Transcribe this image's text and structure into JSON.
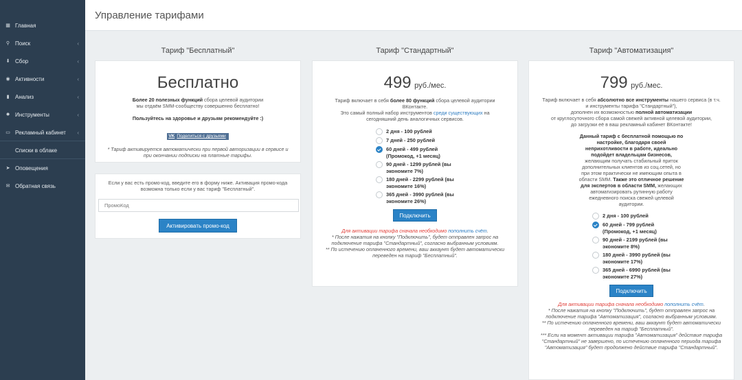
{
  "sidebar": {
    "items": [
      {
        "label": "Главная",
        "icon": "grid-icon",
        "chevron": false
      },
      {
        "label": "Поиск",
        "icon": "search-icon",
        "chevron": true
      },
      {
        "label": "Сбор",
        "icon": "download-icon",
        "chevron": true
      },
      {
        "label": "Активности",
        "icon": "eye-icon",
        "chevron": true
      },
      {
        "label": "Анализ",
        "icon": "chart-icon",
        "chevron": true
      },
      {
        "label": "Инструменты",
        "icon": "gear-icon",
        "chevron": true
      },
      {
        "label": "Рекламный кабинет",
        "icon": "monitor-icon",
        "chevron": true
      },
      {
        "label": "Списки в облаке",
        "icon": "list-icon",
        "chevron": false
      },
      {
        "label": "Оповещения",
        "icon": "send-icon",
        "chevron": false
      },
      {
        "label": "Обратная связь",
        "icon": "mail-icon",
        "chevron": false
      }
    ]
  },
  "header": {
    "title": "Управление тарифами"
  },
  "free": {
    "title": "Тариф \"Бесплатный\"",
    "price": "Бесплатно",
    "desc_bold": "Более 20 полезных функций",
    "desc_1": " сбора целевой аудитории",
    "desc_2": "мы отдаём SMM-сообществу совершенно бесплатно!",
    "recommend": "Пользуйтесь на здоровье и друзьям рекомендуйте :)",
    "vk_label": "VK",
    "share_label": "Поделиться с друзьями",
    "note": "* Тариф активируется автоматически при первой авторизации в сервисе и при окончании подписки на платные тарифы."
  },
  "promo": {
    "text": "Если у вас есть промо-код, введите его в форму ниже. Активация промо-кода возможна только если у вас тариф \"Бесплатный\".",
    "placeholder": "ПромоКод",
    "button": "Активировать промо-код"
  },
  "standard": {
    "title": "Тариф \"Стандартный\"",
    "price": "499",
    "unit": "руб./мес.",
    "desc_a": "Тариф включает в себя ",
    "desc_bold": "более 80 функций",
    "desc_b": " сбора целевой аудитории ВКонтакте.",
    "desc_c": "Это самый полный набор инструментов ",
    "desc_link": "среди существующих",
    "desc_d": " на сегодняшний день аналогичных сервисов.",
    "options": [
      {
        "label": "2 дня - 100 рублей",
        "checked": false
      },
      {
        "label": "7 дней - 250 рублей",
        "checked": false
      },
      {
        "label": "60 дней - 499 рублей (Промокод, +1 месяц)",
        "checked": true
      },
      {
        "label": "90 дней - 1299 рублей (вы экономите 7%)",
        "checked": false
      },
      {
        "label": "180 дней - 2299 рублей (вы экономите 16%)",
        "checked": false
      },
      {
        "label": "365 дней - 3990 рублей (вы экономите 26%)",
        "checked": false
      }
    ],
    "button": "Подключить",
    "warn_red": "Для активации тарифа сначала необходимо",
    "warn_link": "пополнить счёт",
    "warn_dot": ".",
    "note_1": "* После нажатия на кнопку \"Подключить\", будет отправлен запрос на подключение тарифа \"Стандартный\", согласно выбранным условиям.",
    "note_2": "** По истечению оплаченного времени, ваш аккаунт будет автоматически переведен на тариф \"Бесплатный\"."
  },
  "auto": {
    "title": "Тариф \"Автоматизация\"",
    "price": "799",
    "unit": "руб./мес.",
    "desc_a": "Тариф включает в себя ",
    "desc_bold": "абсолютно все инструменты",
    "desc_b": " нашего сервиса (в т.ч. и инструменты тарифа \"Стандартный\"),",
    "desc_c": "дополнен их возможностью ",
    "desc_bold2": "полной автоматизации",
    "desc_d": "от круглосуточного сбора самой свежей активной целевой аудитории,",
    "desc_e": "до загрузки её в ваш рекламный кабинет ВКонтакте!",
    "bold_block": "Данный тариф с бесплатной помощью по настройке, благодаря своей неприхотливости в работе, идеально подойдет владельцам бизнесов,",
    "plain_1": "желающим получать стабильный приток дополнительных клиентов из соц.сетей, но при этом практически не имеющим опыта в области SMM.",
    "bold_2": "Также это отличное решение для экспертов в области SMM,",
    "plain_2": "желающих автоматизировать рутинную работу ежедневного поиска свежей целевой аудитории.",
    "options": [
      {
        "label": "2 дня - 100 рублей",
        "checked": false
      },
      {
        "label": "60 дней - 799 рублей (Промокод, +1 месяц)",
        "checked": true
      },
      {
        "label": "90 дней - 2199 рублей (вы экономите 8%)",
        "checked": false
      },
      {
        "label": "180 дней - 3990 рублей (вы экономите 17%)",
        "checked": false
      },
      {
        "label": "365 дней - 6990 рублей (вы экономите 27%)",
        "checked": false
      }
    ],
    "button": "Подключить",
    "warn_red": "Для активации тарифа сначала необходимо",
    "warn_link": "пополнить счёт",
    "warn_dot": ".",
    "note_1": "* После нажатия на кнопку \"Подключить\", будет отправлен запрос на подключение тарифа \"Автоматизация\", согласно выбранным условиям.",
    "note_2": "** По истечению оплаченного времени, ваш аккаунт будет автоматически переведен на тариф \"Бесплатный\".",
    "note_3": "*** Если на момент активации тарифа \"Автоматизация\" действие тарифа \"Стандартный\" не завершено, по истечению оплаченного периода тарифа \"Автоматизация\" будет продолжено действие тарифа \"Стандартный\"."
  }
}
